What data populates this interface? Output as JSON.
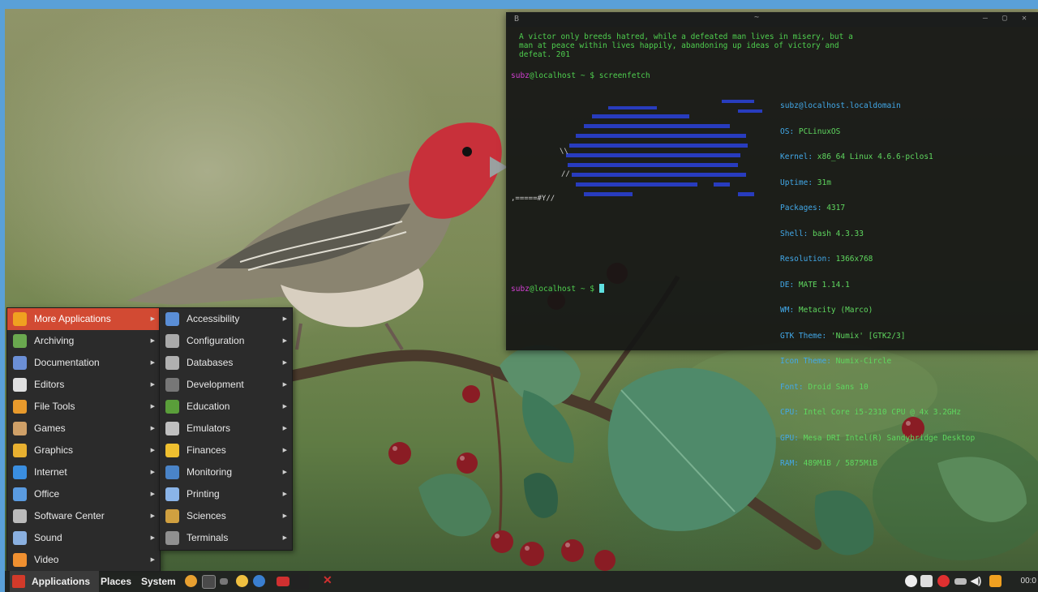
{
  "terminal": {
    "title_left": "B",
    "title_mid": "~",
    "title_buttons": "– ▢ ✕",
    "quote_lines": [
      "A victor only breeds hatred, while a defeated man lives in misery, but a",
      "man at peace within lives happily, abandoning up ideas of victory and",
      "defeat. 201"
    ],
    "prompt1": {
      "user": "subz",
      "host": "@localhost",
      "tail": " ~ $ ",
      "command": "screenfetch"
    },
    "prompt2": {
      "user": "subz",
      "host": "@localhost",
      "tail": " ~ $ "
    },
    "info": [
      {
        "k": "",
        "v": "subz@localhost.localdomain"
      },
      {
        "k": "OS: ",
        "v": "PCLinuxOS"
      },
      {
        "k": "Kernel: ",
        "v": "x86_64 Linux 4.6.6-pclos1"
      },
      {
        "k": "Uptime: ",
        "v": "31m"
      },
      {
        "k": "Packages: ",
        "v": "4317"
      },
      {
        "k": "Shell: ",
        "v": "bash 4.3.33"
      },
      {
        "k": "Resolution: ",
        "v": "1366x768"
      },
      {
        "k": "DE: ",
        "v": "MATE 1.14.1"
      },
      {
        "k": "WM: ",
        "v": "Metacity (Marco)"
      },
      {
        "k": "GTK Theme: ",
        "v": "'Numix' [GTK2/3]"
      },
      {
        "k": "Icon Theme: ",
        "v": "Numix-Circle"
      },
      {
        "k": "Font: ",
        "v": "Droid Sans 10"
      },
      {
        "k": "CPU: ",
        "v": "Intel Core i5-2310 CPU @ 4x 3.2GHz"
      },
      {
        "k": "GPU: ",
        "v": "Mesa DRI Intel(R) Sandybridge Desktop"
      },
      {
        "k": "RAM: ",
        "v": "489MiB / 5875MiB"
      }
    ]
  },
  "menu_main": [
    {
      "label": "More Applications",
      "icon": "more-apps-icon",
      "color": "#f0a020",
      "active": true
    },
    {
      "label": "Archiving",
      "icon": "archive-icon",
      "color": "#6aa84f"
    },
    {
      "label": "Documentation",
      "icon": "documentation-icon",
      "color": "#6b8fd6"
    },
    {
      "label": "Editors",
      "icon": "editors-icon",
      "color": "#e0e0e0"
    },
    {
      "label": "File Tools",
      "icon": "file-tools-icon",
      "color": "#e89a2c"
    },
    {
      "label": "Games",
      "icon": "games-icon",
      "color": "#cfa068"
    },
    {
      "label": "Graphics",
      "icon": "graphics-icon",
      "color": "#e8b030"
    },
    {
      "label": "Internet",
      "icon": "internet-icon",
      "color": "#3a8ee0"
    },
    {
      "label": "Office",
      "icon": "office-icon",
      "color": "#5a9be0"
    },
    {
      "label": "Software Center",
      "icon": "software-center-icon",
      "color": "#bbbbbb"
    },
    {
      "label": "Sound",
      "icon": "sound-icon",
      "color": "#8ab0e0"
    },
    {
      "label": "Video",
      "icon": "video-icon",
      "color": "#f09030"
    }
  ],
  "menu_sub": [
    {
      "label": "Accessibility",
      "icon": "accessibility-icon",
      "color": "#5a8ed6"
    },
    {
      "label": "Configuration",
      "icon": "configuration-icon",
      "color": "#aaaaaa"
    },
    {
      "label": "Databases",
      "icon": "databases-icon",
      "color": "#b0b0b0"
    },
    {
      "label": "Development",
      "icon": "development-icon",
      "color": "#777777"
    },
    {
      "label": "Education",
      "icon": "education-icon",
      "color": "#5a9e3a"
    },
    {
      "label": "Emulators",
      "icon": "emulators-icon",
      "color": "#c0c0c0"
    },
    {
      "label": "Finances",
      "icon": "finances-icon",
      "color": "#f0c030"
    },
    {
      "label": "Monitoring",
      "icon": "monitoring-icon",
      "color": "#4a84c8"
    },
    {
      "label": "Printing",
      "icon": "printing-icon",
      "color": "#8ab4e8"
    },
    {
      "label": "Sciences",
      "icon": "sciences-icon",
      "color": "#d0a040"
    },
    {
      "label": "Terminals",
      "icon": "terminals-icon",
      "color": "#909090"
    }
  ],
  "panel": {
    "applications": "Applications",
    "places": "Places",
    "system": "System",
    "clock": "00:0"
  }
}
